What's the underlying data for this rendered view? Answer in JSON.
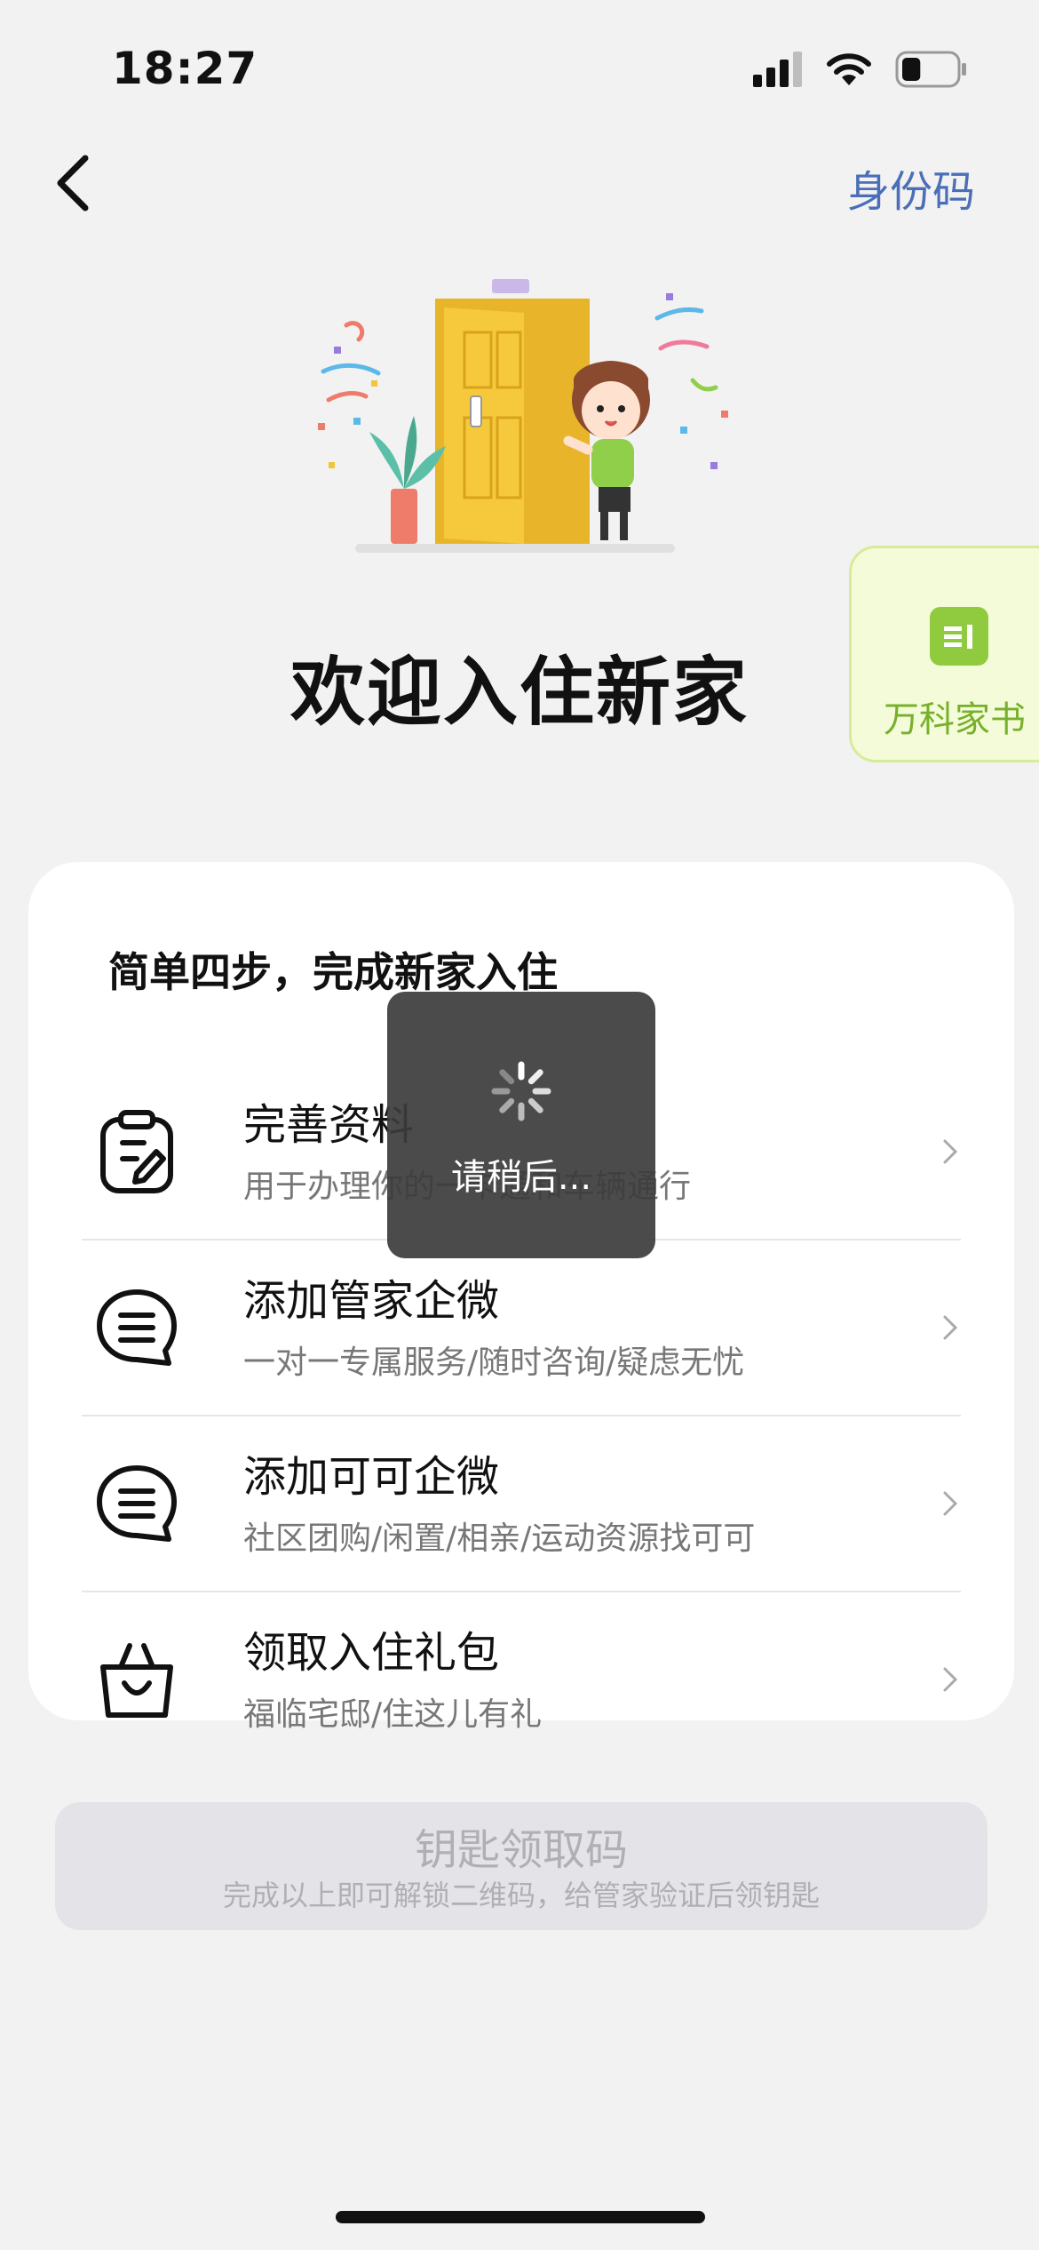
{
  "status_bar": {
    "time": "18:27",
    "battery_level": 0.35
  },
  "nav": {
    "back_icon": "chevron-left-icon",
    "id_code_label": "身份码"
  },
  "hero": {
    "heading": "欢迎入住新家"
  },
  "side_tab": {
    "label": "万科家书",
    "icon": "book-icon"
  },
  "card": {
    "title": "简单四步，完成新家入住",
    "steps": [
      {
        "icon": "profile-edit-icon",
        "title": "完善资料",
        "subtitle": "用于办理你的一卡通和车辆通行"
      },
      {
        "icon": "chat-icon",
        "title": "添加管家企微",
        "subtitle": "一对一专属服务/随时咨询/疑虑无忧"
      },
      {
        "icon": "chat-icon",
        "title": "添加可可企微",
        "subtitle": "社区团购/闲置/相亲/运动资源找可可"
      },
      {
        "icon": "gift-bag-icon",
        "title": "领取入住礼包",
        "subtitle": "福临宅邸/住这儿有礼"
      }
    ]
  },
  "key_button": {
    "title": "钥匙领取码",
    "subtitle": "完成以上即可解锁二维码，给管家验证后领钥匙"
  },
  "loading_toast": {
    "message": "请稍后..."
  },
  "colors": {
    "accent_blue": "#4a6fb8",
    "side_tab_green": "#77b02a",
    "door_yellow": "#f2c53a"
  }
}
